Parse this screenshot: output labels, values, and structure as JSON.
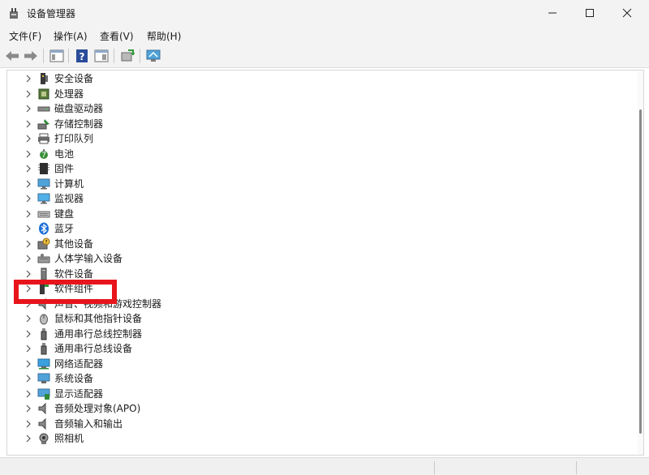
{
  "window": {
    "title": "设备管理器",
    "controls": [
      "minimize-icon",
      "maximize-icon",
      "close-icon"
    ]
  },
  "menu": [
    {
      "label": "文件(F)"
    },
    {
      "label": "操作(A)"
    },
    {
      "label": "查看(V)"
    },
    {
      "label": "帮助(H)"
    }
  ],
  "toolbar": {
    "buttons": [
      "back-arrow-icon",
      "forward-arrow-icon",
      "properties-panel-icon",
      "help-icon",
      "console-tree-icon",
      "update-driver-icon",
      "scan-hardware-icon"
    ]
  },
  "tree": {
    "items": [
      {
        "label": "安全设备",
        "icon": "security-chip-icon"
      },
      {
        "label": "处理器",
        "icon": "processor-icon"
      },
      {
        "label": "磁盘驱动器",
        "icon": "disk-drive-icon"
      },
      {
        "label": "存储控制器",
        "icon": "storage-controller-icon"
      },
      {
        "label": "打印队列",
        "icon": "printer-icon"
      },
      {
        "label": "电池",
        "icon": "battery-icon"
      },
      {
        "label": "固件",
        "icon": "firmware-icon"
      },
      {
        "label": "计算机",
        "icon": "computer-icon"
      },
      {
        "label": "监视器",
        "icon": "monitor-icon"
      },
      {
        "label": "键盘",
        "icon": "keyboard-icon"
      },
      {
        "label": "蓝牙",
        "icon": "bluetooth-icon"
      },
      {
        "label": "其他设备",
        "icon": "unknown-device-icon"
      },
      {
        "label": "人体学输入设备",
        "icon": "human-interface-icon"
      },
      {
        "label": "软件设备",
        "icon": "software-device-icon"
      },
      {
        "label": "软件组件",
        "icon": "software-component-icon"
      },
      {
        "label": "声音、视频和游戏控制器",
        "icon": "speaker-icon"
      },
      {
        "label": "鼠标和其他指针设备",
        "icon": "mouse-icon"
      },
      {
        "label": "通用串行总线控制器",
        "icon": "usb-controller-icon"
      },
      {
        "label": "通用串行总线设备",
        "icon": "usb-device-icon"
      },
      {
        "label": "网络适配器",
        "icon": "network-adapter-icon"
      },
      {
        "label": "系统设备",
        "icon": "system-device-icon"
      },
      {
        "label": "显示适配器",
        "icon": "display-adapter-icon"
      },
      {
        "label": "音频处理对象(APO)",
        "icon": "audio-processing-icon"
      },
      {
        "label": "音频输入和输出",
        "icon": "audio-io-icon"
      },
      {
        "label": "照相机",
        "icon": "camera-icon"
      }
    ]
  },
  "colors": {
    "highlight_box": "#e8141b",
    "chrome_background": "#f3f3f3",
    "tree_background": "#ffffff"
  }
}
